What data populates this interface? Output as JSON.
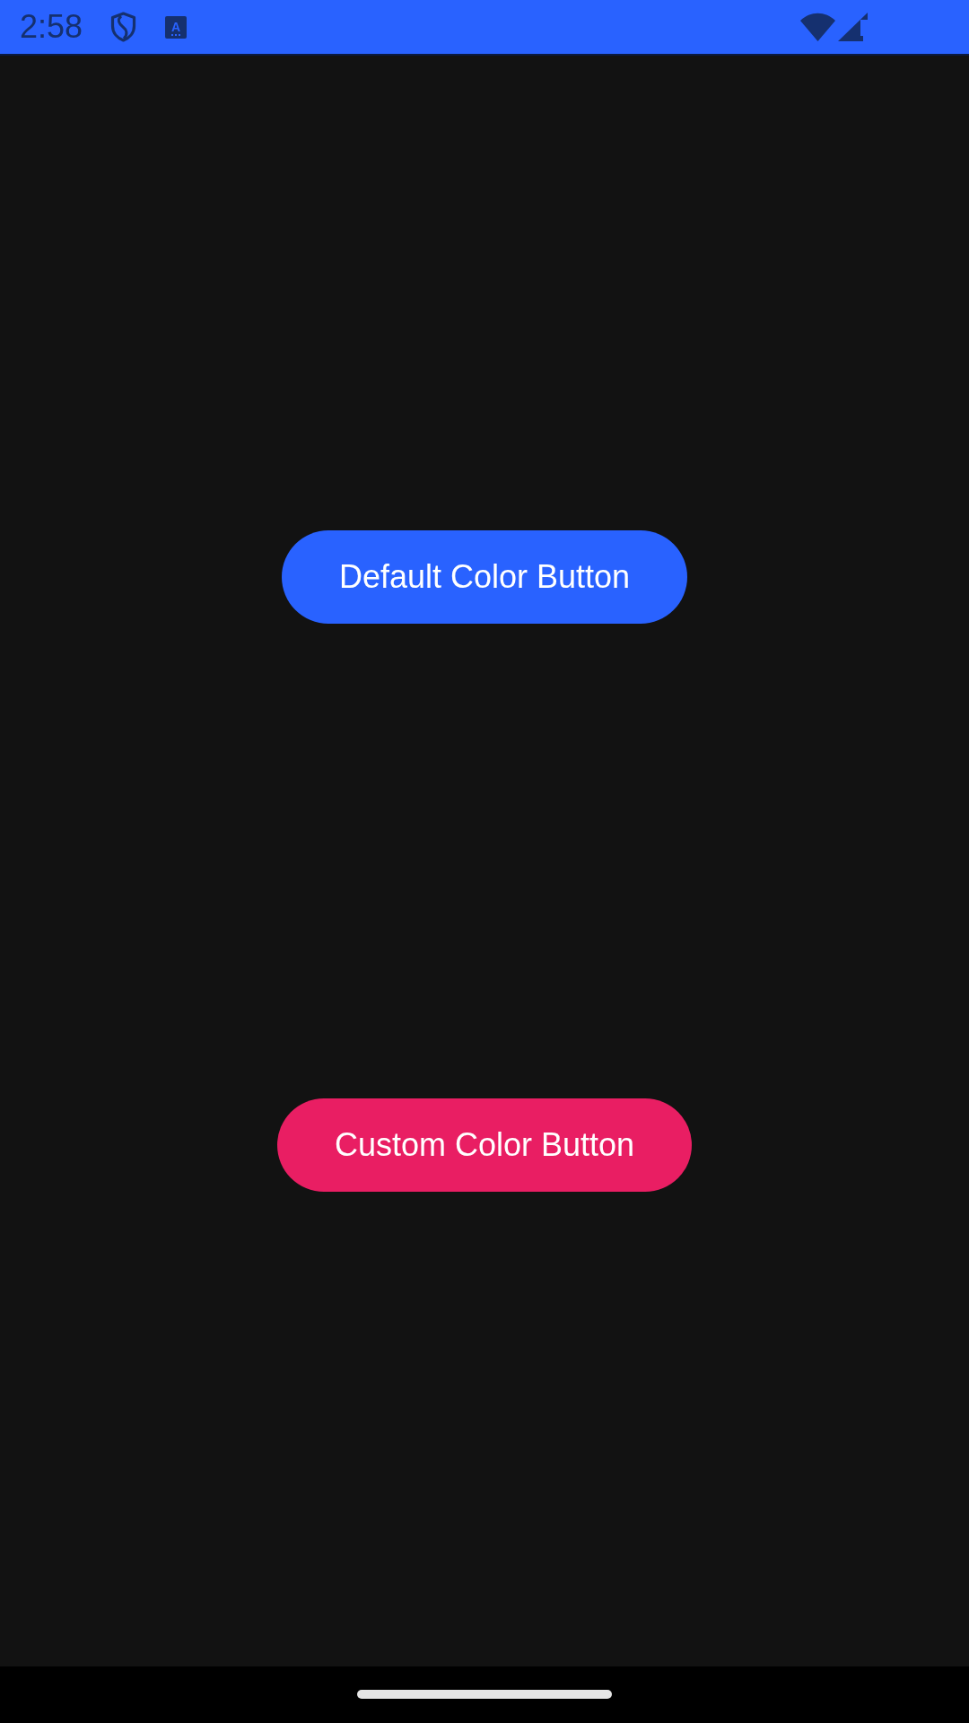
{
  "status_bar": {
    "time": "2:58",
    "badge_letter": "A"
  },
  "buttons": [
    {
      "label": "Default Color Button",
      "color": "#2962ff"
    },
    {
      "label": "Custom Color Button",
      "color": "#e91e63"
    }
  ]
}
